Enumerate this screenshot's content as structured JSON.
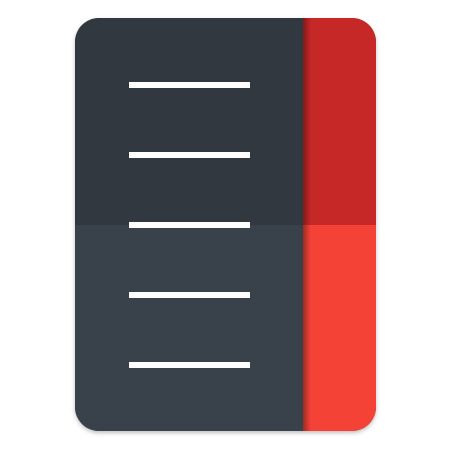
{
  "icon": {
    "name": "ruler-notepad-icon",
    "line_count": 5,
    "colors": {
      "body_top": "#323840",
      "body_bottom": "#39414a",
      "tab_top": "#c62828",
      "tab_bottom": "#f44336",
      "line": "#ffffff",
      "background": "#ffffff"
    }
  }
}
